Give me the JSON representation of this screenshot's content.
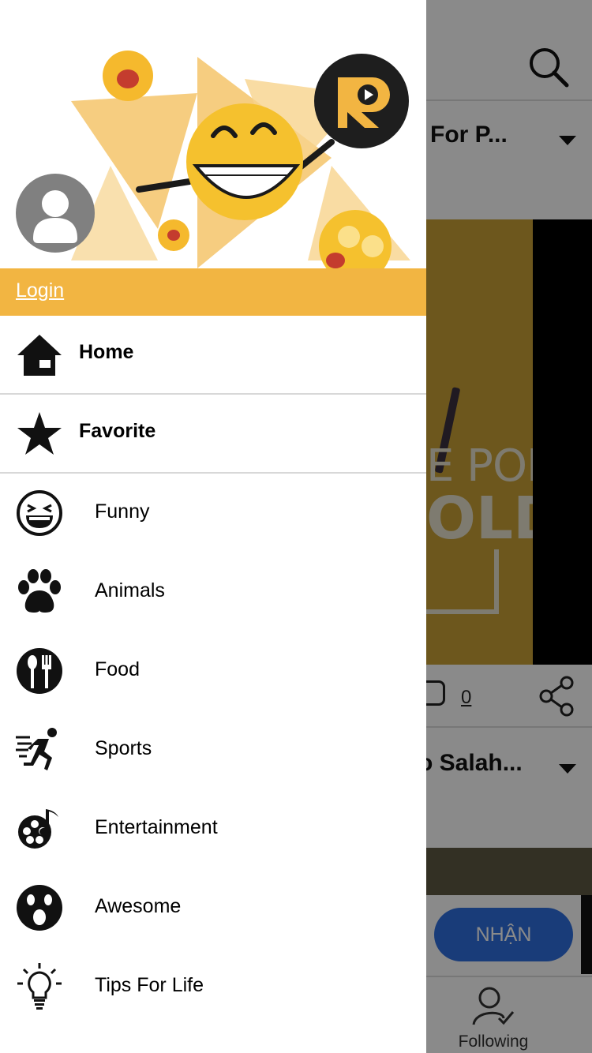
{
  "background": {
    "card1_title": "ts For P...",
    "card2_title": "o Salah...",
    "image_text_line1": "E POP",
    "image_text_line2": "OLD",
    "comment_count": "0",
    "ad_button_label": "NHẬN",
    "tab_following_label": "Following"
  },
  "drawer": {
    "login_label": "Login",
    "primary_items": [
      {
        "label": "Home",
        "icon": "home-icon"
      },
      {
        "label": "Favorite",
        "icon": "star-icon"
      }
    ],
    "categories": [
      {
        "label": "Funny",
        "icon": "laughing-face-icon"
      },
      {
        "label": "Animals",
        "icon": "paw-icon"
      },
      {
        "label": "Food",
        "icon": "fork-spoon-icon"
      },
      {
        "label": "Sports",
        "icon": "runner-icon"
      },
      {
        "label": "Entertainment",
        "icon": "film-music-icon"
      },
      {
        "label": "Awesome",
        "icon": "surprised-face-icon"
      },
      {
        "label": "Tips For Life",
        "icon": "lightbulb-icon"
      }
    ]
  },
  "colors": {
    "accent": "#f2b542",
    "cta_blue": "#2f6fe0",
    "avatar_gray": "#808080"
  }
}
